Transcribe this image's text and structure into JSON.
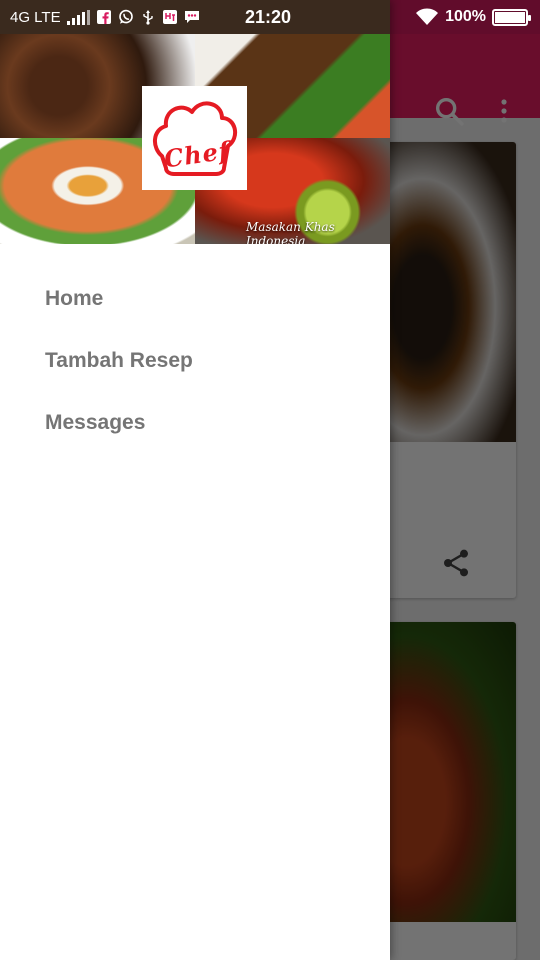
{
  "status_bar": {
    "network": "4G LTE",
    "clock": "21:20",
    "battery_percent": "100%",
    "battery_level": 1.0,
    "icons": [
      "signal-icon",
      "facebook-icon",
      "whatsapp-icon",
      "usb-icon",
      "vpn-icon",
      "chat-icon",
      "wifi-icon",
      "battery-icon"
    ]
  },
  "toolbar": {
    "icons": [
      "search-icon",
      "more-vert-icon"
    ]
  },
  "drawer": {
    "header": {
      "logo_text": "Chef",
      "caption": "Masakan Khas Indonesia"
    },
    "menu": [
      {
        "label": "Home"
      },
      {
        "label": "Tambah Resep"
      },
      {
        "label": "Messages"
      }
    ]
  },
  "feed": {
    "card_icons": [
      "share-icon"
    ]
  },
  "colors": {
    "primary": "#e91e63",
    "primary_dark": "#d81b60",
    "menu_text": "#757575",
    "logo_red": "#e51b23"
  }
}
